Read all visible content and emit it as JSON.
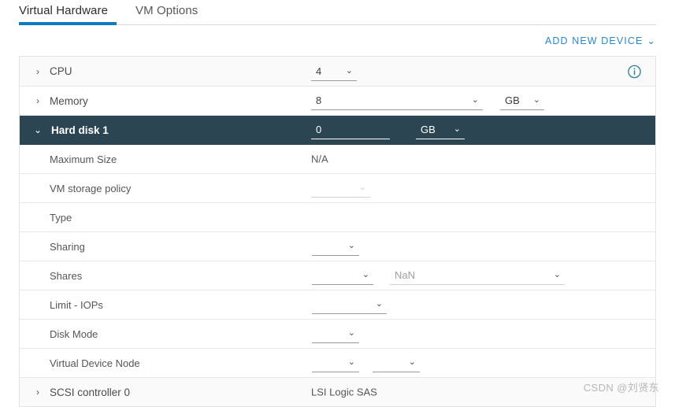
{
  "colors": {
    "accent": "#0e7dc0",
    "link": "#2a87c8",
    "selected_row_bg": "#2c4553",
    "info_icon": "#2a7f96"
  },
  "tabs": [
    {
      "label": "Virtual Hardware",
      "active": true
    },
    {
      "label": "VM Options",
      "active": false
    }
  ],
  "toolbar": {
    "add_new_device_label": "ADD NEW DEVICE",
    "chevron": "⌄"
  },
  "icons": {
    "chevron_right": "›",
    "chevron_down": "⌄",
    "caret_collapsed": "❯",
    "caret_expanded": "⌄"
  },
  "device_rows": [
    {
      "name": "CPU",
      "expanded": false,
      "value": "4",
      "has_info": true
    },
    {
      "name": "Memory",
      "expanded": false,
      "value": "8",
      "unit": "GB"
    },
    {
      "name": "Hard disk 1",
      "expanded": true,
      "value": "0",
      "unit": "GB",
      "selected": true
    }
  ],
  "hard_disk_details": [
    {
      "label": "Maximum Size",
      "type": "static",
      "value": "N/A"
    },
    {
      "label": "VM storage policy",
      "type": "select",
      "value": "",
      "disabled": true
    },
    {
      "label": "Type",
      "type": "none",
      "value": ""
    },
    {
      "label": "Sharing",
      "type": "select",
      "value": ""
    },
    {
      "label": "Shares",
      "type": "select-pair",
      "value": "",
      "value2_placeholder": "NaN"
    },
    {
      "label": "Limit - IOPs",
      "type": "select",
      "value": ""
    },
    {
      "label": "Disk Mode",
      "type": "select",
      "value": ""
    },
    {
      "label": "Virtual Device Node",
      "type": "select-dual",
      "value": "",
      "value2": ""
    }
  ],
  "footer_row": {
    "name": "SCSI controller 0",
    "value": "LSI Logic SAS",
    "expanded": false
  },
  "watermark": "CSDN @刘贤东"
}
